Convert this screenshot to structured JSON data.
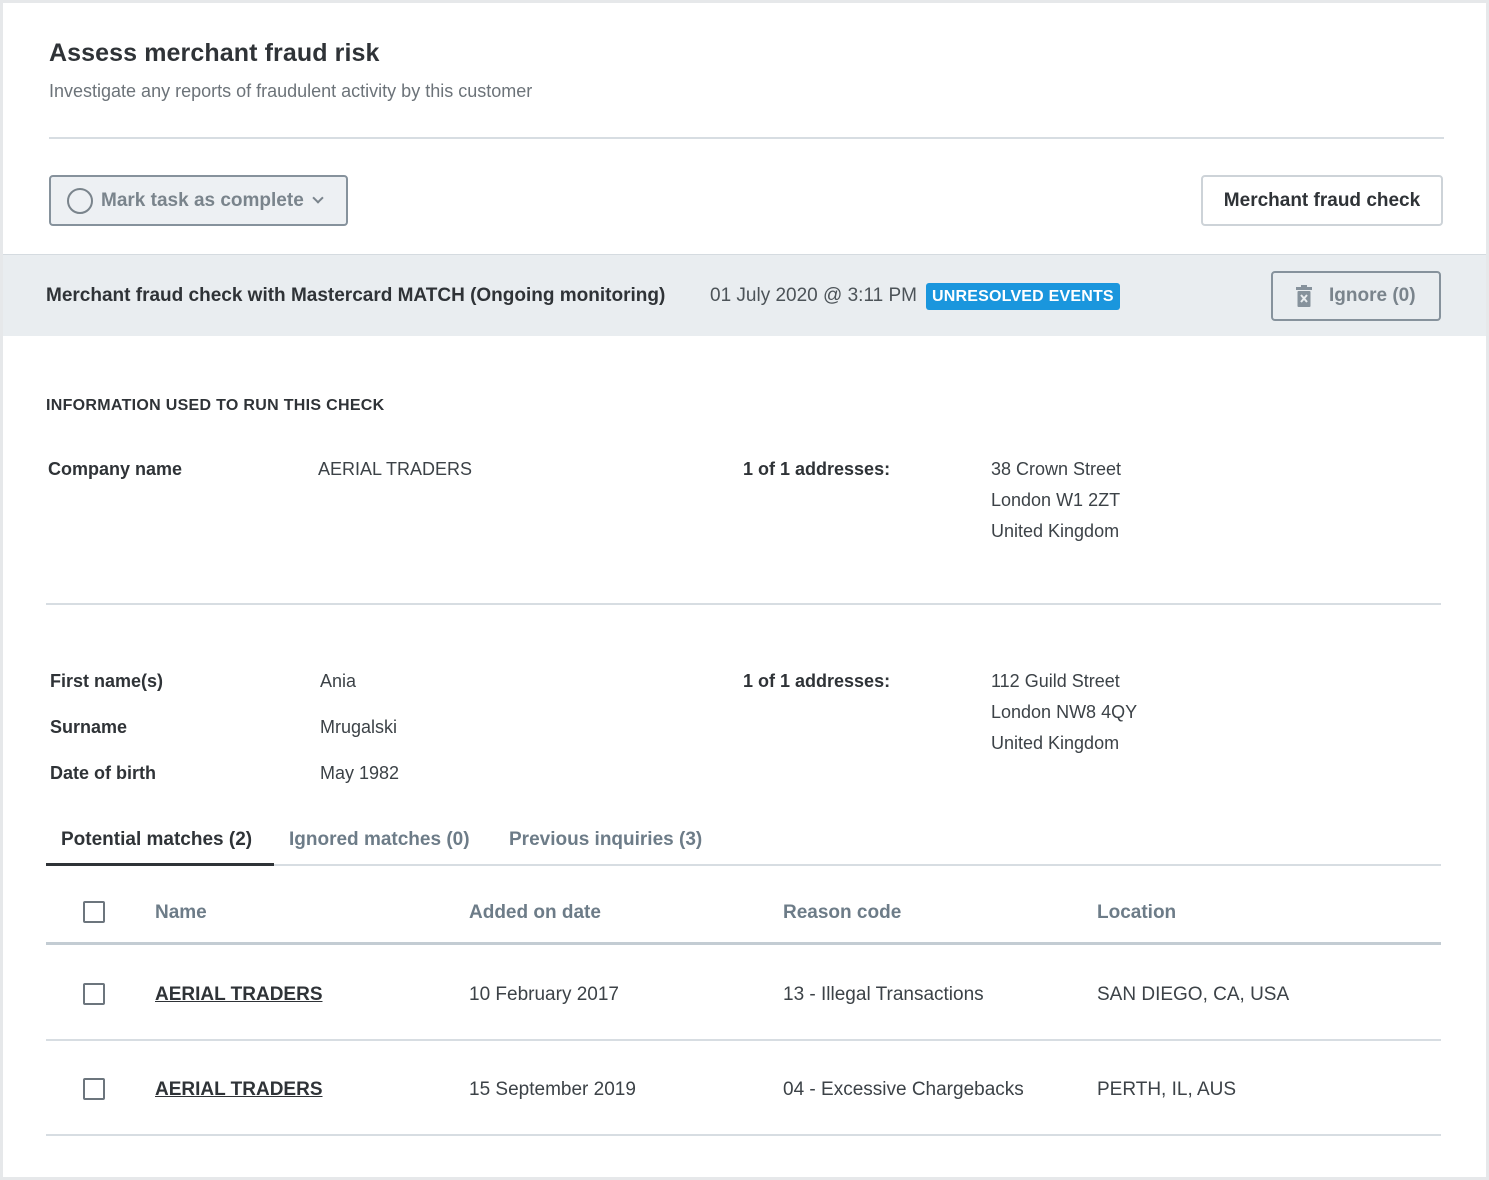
{
  "header": {
    "title": "Assess merchant fraud risk",
    "subtitle": "Investigate any reports of fraudulent activity by this customer"
  },
  "toolbar": {
    "mark_complete_label": "Mark task as complete",
    "fraud_check_label": "Merchant fraud check"
  },
  "check": {
    "title": "Merchant fraud check with Mastercard MATCH (Ongoing monitoring)",
    "date": "01 July 2020 @ 3:11 PM",
    "status_badge": "UNRESOLVED EVENTS",
    "ignore_label": "Ignore (0)"
  },
  "info": {
    "heading": "INFORMATION USED TO RUN THIS CHECK",
    "company": {
      "name_label": "Company name",
      "name_value": "AERIAL TRADERS",
      "address_label": "1 of 1 addresses:",
      "address_lines": [
        "38 Crown Street",
        "London W1 2ZT",
        "United Kingdom"
      ]
    },
    "person": {
      "first_name_label": "First name(s)",
      "first_name_value": "Ania",
      "surname_label": "Surname",
      "surname_value": "Mrugalski",
      "dob_label": "Date of birth",
      "dob_value": "May 1982",
      "address_label": "1 of 1 addresses:",
      "address_lines": [
        "112 Guild Street",
        "London NW8 4QY",
        "United Kingdom"
      ]
    }
  },
  "tabs": [
    {
      "label": "Potential matches (2)",
      "active": true
    },
    {
      "label": "Ignored matches (0)",
      "active": false
    },
    {
      "label": "Previous inquiries (3)",
      "active": false
    }
  ],
  "table": {
    "columns": [
      "Name",
      "Added on date",
      "Reason code",
      "Location"
    ],
    "rows": [
      {
        "name": "AERIAL TRADERS",
        "added": "10 February 2017",
        "reason": "13 - Illegal Transactions",
        "location": "SAN DIEGO, CA, USA"
      },
      {
        "name": "AERIAL TRADERS",
        "added": "15 September 2019",
        "reason": "04 - Excessive Chargebacks",
        "location": "PERTH, IL, AUS"
      }
    ]
  },
  "colors": {
    "badge": "#1a96dd",
    "band": "#e9edf0"
  }
}
